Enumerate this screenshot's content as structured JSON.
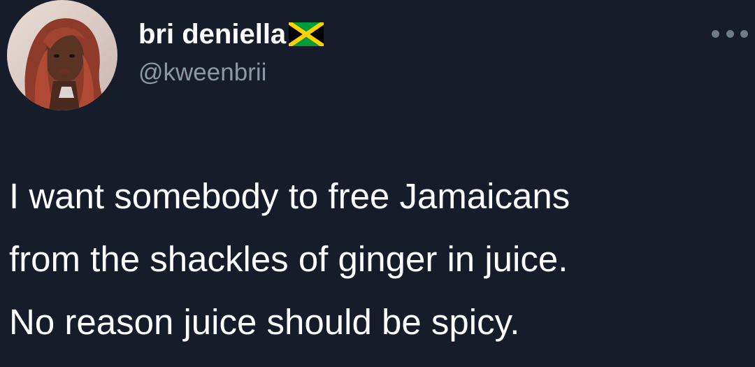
{
  "tweet": {
    "display_name": "bri deniella",
    "handle": "@kweenbrii",
    "flag_icon": "jamaica-flag-icon",
    "more_icon": "more-options-icon",
    "text_lines": [
      "I want somebody to free Jamaicans",
      "from the shackles of ginger in juice.",
      "No reason juice should be spicy."
    ]
  },
  "colors": {
    "background": "#161c2a",
    "text": "#ffffff",
    "secondary_text": "#8b98a5",
    "flag_green": "#009b3a",
    "flag_gold": "#fed100",
    "flag_black": "#000000"
  }
}
